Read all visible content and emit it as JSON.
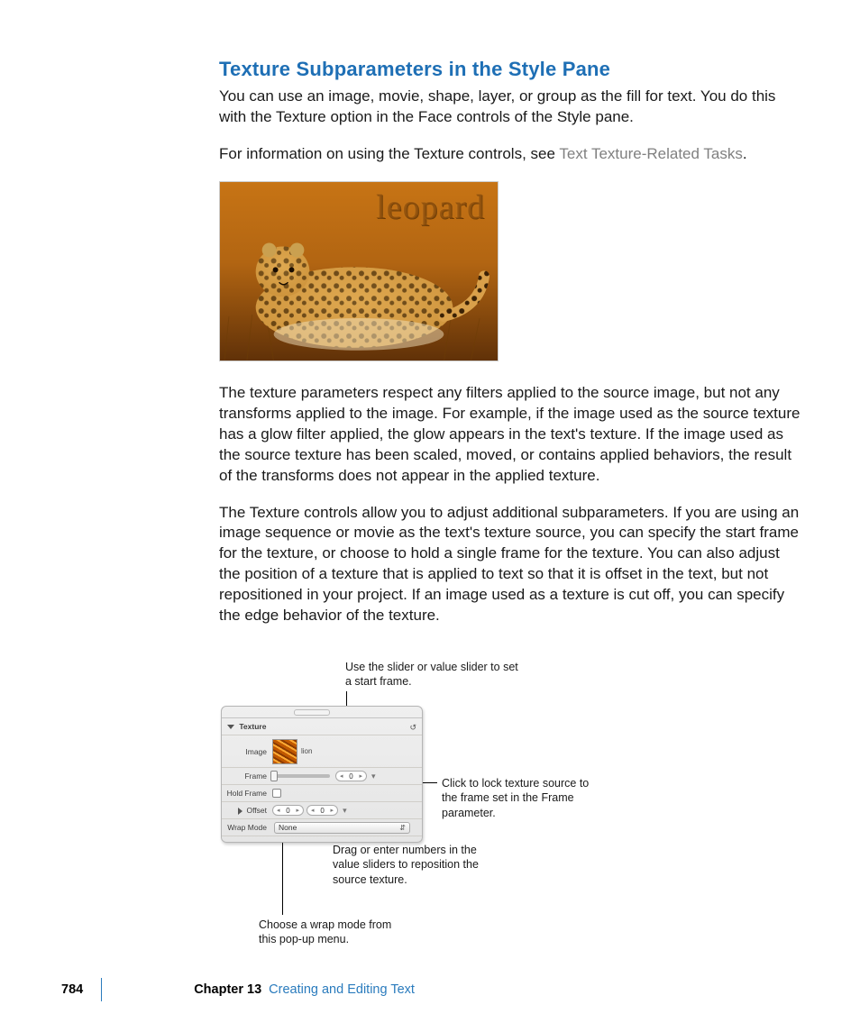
{
  "heading": "Texture Subparameters in the Style Pane",
  "para1": "You can use an image, movie, shape, layer, or group as the fill for text. You do this with the Texture option in the Face controls of the Style pane.",
  "para2_pre": "For information on using the Texture controls, see ",
  "para2_link": "Text Texture-Related Tasks",
  "para2_post": ".",
  "leopard_caption": "leopard",
  "para3": "The texture parameters respect any filters applied to the source image, but not any transforms applied to the image. For example, if the image used as the source texture has a glow filter applied, the glow appears in the text's texture. If the image used as the source texture has been scaled, moved, or contains applied behaviors, the result of the transforms does not appear in the applied texture.",
  "para4": "The Texture controls allow you to adjust additional subparameters. If you are using an image sequence or movie as the text's texture source, you can specify the start frame for the texture, or choose to hold a single frame for the texture. You can also adjust the position of a texture that is applied to text so that it is offset in the text, but not repositioned in your project. If an image used as a texture is cut off, you can specify the edge behavior of the texture.",
  "panel": {
    "section": "Texture",
    "image_label": "Image",
    "image_thumb_name": "lion",
    "frame_label": "Frame",
    "frame_value": "0",
    "holdframe_label": "Hold Frame",
    "offset_label": "Offset",
    "offset_x": "0",
    "offset_y": "0",
    "wrapmode_label": "Wrap Mode",
    "wrapmode_value": "None"
  },
  "callouts": {
    "top": "Use the slider or value slider to set a start frame.",
    "right": "Click to lock texture source to the frame set in the Frame parameter.",
    "mid": "Drag or enter numbers in the value sliders to reposition the source texture.",
    "left": "Choose a wrap mode from this pop-up menu."
  },
  "footer": {
    "page": "784",
    "chapter_label": "Chapter 13",
    "chapter_title": "Creating and Editing Text"
  }
}
